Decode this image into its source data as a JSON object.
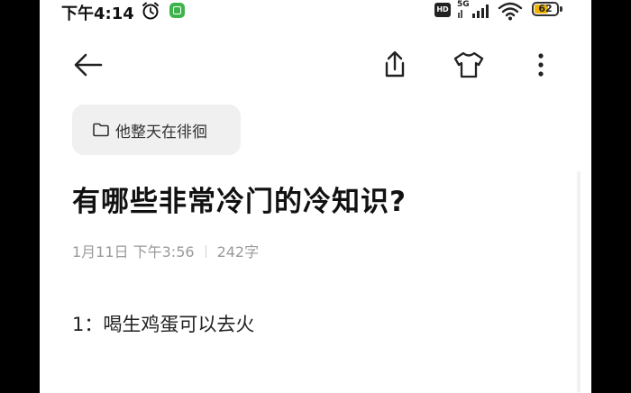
{
  "status_bar": {
    "time": "下午4:14",
    "hd": "HD",
    "network": "5G",
    "battery": "62",
    "battery_level": 0.62
  },
  "toolbar": {
    "back_icon": "arrow-left-icon",
    "share_icon": "share-icon",
    "theme_icon": "tshirt-icon",
    "more_icon": "more-vertical-icon"
  },
  "note": {
    "folder": "他整天在徘徊",
    "title": "有哪些非常冷门的冷知识?",
    "date": "1月11日 下午3:56",
    "word_count": "242字",
    "body": [
      "1：喝生鸡蛋可以去火"
    ]
  }
}
